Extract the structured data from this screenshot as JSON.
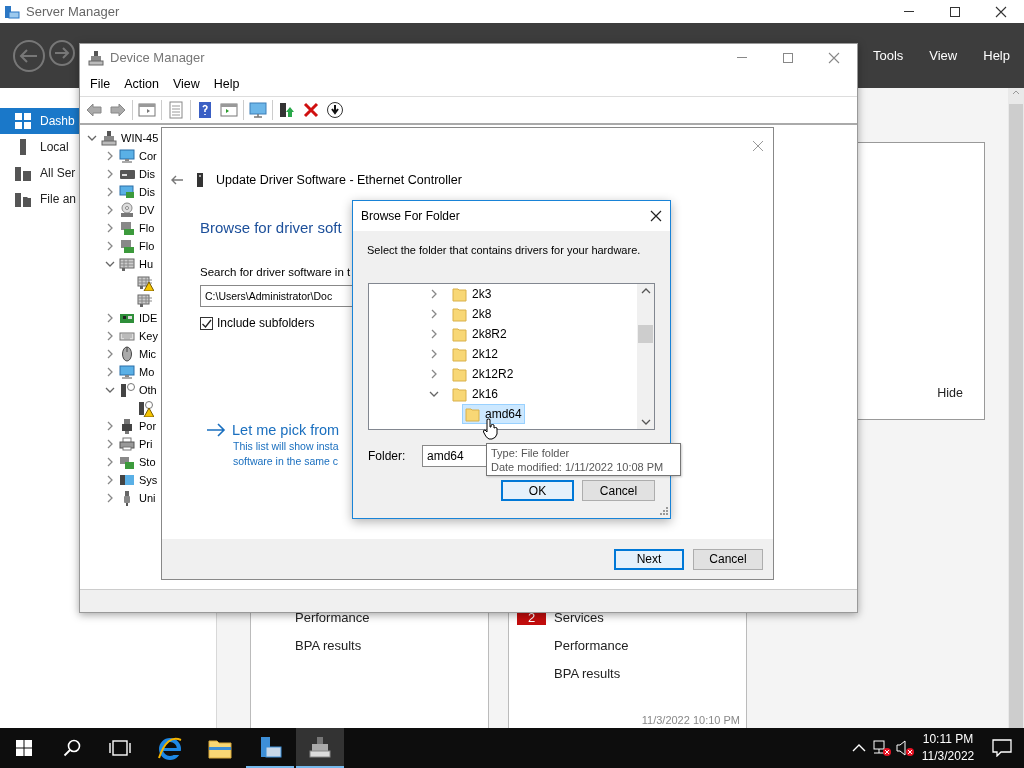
{
  "server_manager": {
    "title": "Server Manager",
    "menu": [
      "Tools",
      "View",
      "Help"
    ],
    "sidebar": [
      {
        "label": "Dashb",
        "selected": true
      },
      {
        "label": "Local",
        "selected": false
      },
      {
        "label": "All Ser",
        "selected": false
      },
      {
        "label": "File an",
        "selected": false
      }
    ],
    "welcome_panel": {
      "hide_link": "Hide"
    },
    "tiles": [
      {
        "rows": [
          {
            "label": "Performance"
          },
          {
            "label": "BPA results"
          }
        ]
      },
      {
        "rows": [
          {
            "badge": "2",
            "label": "Services"
          },
          {
            "label": "Performance"
          },
          {
            "label": "BPA results"
          }
        ],
        "timestamp": "11/3/2022 10:10 PM"
      }
    ]
  },
  "device_manager": {
    "title": "Device Manager",
    "menu": [
      "File",
      "Action",
      "View",
      "Help"
    ],
    "tree": {
      "label": "WIN-45",
      "expanded": true,
      "children": [
        {
          "label": "Cor",
          "expanded": false
        },
        {
          "label": "Dis",
          "expanded": false
        },
        {
          "label": "Dis",
          "expanded": false
        },
        {
          "label": "DV",
          "expanded": false
        },
        {
          "label": "Flo",
          "expanded": false
        },
        {
          "label": "Flo",
          "expanded": false
        },
        {
          "label": "Hu",
          "expanded": true,
          "children": [
            {
              "warning": true
            },
            {
              "warning": false
            }
          ]
        },
        {
          "label": "IDE",
          "expanded": false
        },
        {
          "label": "Key",
          "expanded": false
        },
        {
          "label": "Mic",
          "expanded": false
        },
        {
          "label": "Mo",
          "expanded": false
        },
        {
          "label": "Oth",
          "expanded": true,
          "children": [
            {
              "warning": true
            }
          ]
        },
        {
          "label": "Por",
          "expanded": false
        },
        {
          "label": "Pri",
          "expanded": false
        },
        {
          "label": "Sto",
          "expanded": false
        },
        {
          "label": "Sys",
          "expanded": false
        },
        {
          "label": "Uni",
          "expanded": false
        }
      ]
    }
  },
  "update_driver": {
    "title": "Update Driver Software - Ethernet Controller",
    "heading": "Browse for driver soft",
    "search_label": "Search for driver software in t",
    "path": "C:\\Users\\Administrator\\Doc",
    "include_subfolders": {
      "label": "Include subfolders",
      "checked": true
    },
    "pick_option": {
      "title": "Let me pick from",
      "description": [
        "This list will show insta",
        "software in the same c"
      ]
    },
    "buttons": [
      {
        "label": "Next",
        "default": true
      },
      {
        "label": "Cancel",
        "default": false
      }
    ]
  },
  "browse_folder": {
    "title": "Browse For Folder",
    "instruction": "Select the folder that contains drivers for your hardware.",
    "folders": [
      {
        "label": "2k3",
        "expanded": false,
        "selected": false
      },
      {
        "label": "2k8",
        "expanded": false,
        "selected": false
      },
      {
        "label": "2k8R2",
        "expanded": false,
        "selected": false
      },
      {
        "label": "2k12",
        "expanded": false,
        "selected": false
      },
      {
        "label": "2k12R2",
        "expanded": false,
        "selected": false
      },
      {
        "label": "2k16",
        "expanded": true,
        "selected": false,
        "children": [
          {
            "label": "amd64",
            "selected": true
          }
        ]
      }
    ],
    "folder_label": "Folder:",
    "folder_value": "amd64",
    "buttons": [
      {
        "label": "OK",
        "default": true
      },
      {
        "label": "Cancel",
        "default": false
      }
    ]
  },
  "tooltip": {
    "lines": [
      "Type: File folder",
      "Date modified: 1/11/2022 10:08 PM"
    ]
  },
  "taskbar": {
    "apps": [
      {
        "running": false,
        "selected": false
      },
      {
        "running": false,
        "selected": false
      },
      {
        "running": true,
        "selected": false
      },
      {
        "running": true,
        "selected": true
      }
    ],
    "clock": {
      "time": "10:11 PM",
      "date": "11/3/2022"
    }
  }
}
